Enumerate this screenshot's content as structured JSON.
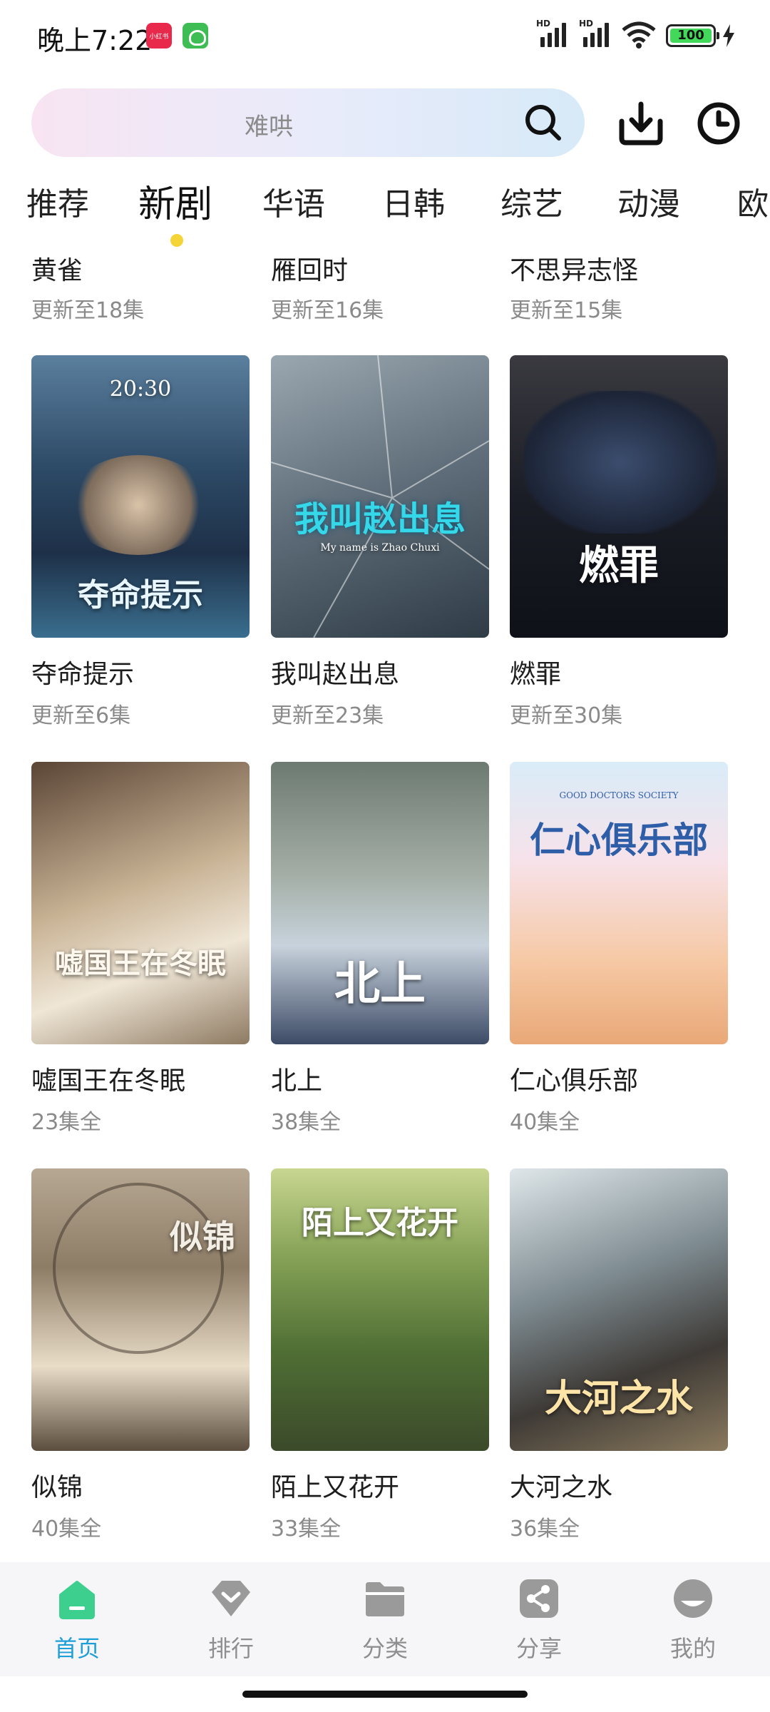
{
  "status": {
    "time": "晚上7:22",
    "app_badge_1": "小红书",
    "battery": "100",
    "sig1_label": "HD",
    "sig2_label": "HD"
  },
  "search": {
    "placeholder": "难哄"
  },
  "tabs": [
    {
      "label": "推荐",
      "active": false
    },
    {
      "label": "新剧",
      "active": true
    },
    {
      "label": "华语",
      "active": false
    },
    {
      "label": "日韩",
      "active": false
    },
    {
      "label": "综艺",
      "active": false
    },
    {
      "label": "动漫",
      "active": false
    },
    {
      "label": "欧",
      "active": false
    }
  ],
  "top_row": [
    {
      "title": "黄雀",
      "sub": "更新至18集"
    },
    {
      "title": "雁回时",
      "sub": "更新至16集"
    },
    {
      "title": "不思异志怪",
      "sub": "更新至15集"
    }
  ],
  "grid": [
    {
      "title": "夺命提示",
      "sub": "更新至6集",
      "poster_text": "夺命提示",
      "poster_sub": "20:30"
    },
    {
      "title": "我叫赵出息",
      "sub": "更新至23集",
      "poster_text": "我叫赵出息",
      "poster_sub": "My name is Zhao Chuxi"
    },
    {
      "title": "燃罪",
      "sub": "更新至30集",
      "poster_text": "燃罪",
      "poster_sub": ""
    },
    {
      "title": "嘘国王在冬眠",
      "sub": "23集全",
      "poster_text": "嘘国王在冬眠",
      "poster_sub": ""
    },
    {
      "title": "北上",
      "sub": "38集全",
      "poster_text": "北上",
      "poster_sub": ""
    },
    {
      "title": "仁心俱乐部",
      "sub": "40集全",
      "poster_text": "仁心俱乐部",
      "poster_sub": "GOOD DOCTORS SOCIETY"
    },
    {
      "title": "似锦",
      "sub": "40集全",
      "poster_text": "似锦",
      "poster_sub": ""
    },
    {
      "title": "陌上又花开",
      "sub": "33集全",
      "poster_text": "陌上又花开",
      "poster_sub": ""
    },
    {
      "title": "大河之水",
      "sub": "36集全",
      "poster_text": "大河之水",
      "poster_sub": ""
    }
  ],
  "nav": [
    {
      "label": "首页",
      "icon": "home-icon",
      "active": true
    },
    {
      "label": "排行",
      "icon": "ranking-icon",
      "active": false
    },
    {
      "label": "分类",
      "icon": "folder-icon",
      "active": false
    },
    {
      "label": "分享",
      "icon": "share-icon",
      "active": false
    },
    {
      "label": "我的",
      "icon": "profile-icon",
      "active": false
    }
  ],
  "colors": {
    "accent": "#1e9fd8",
    "home_icon": "#3ccf8e",
    "tab_dot": "#f5d43a"
  }
}
